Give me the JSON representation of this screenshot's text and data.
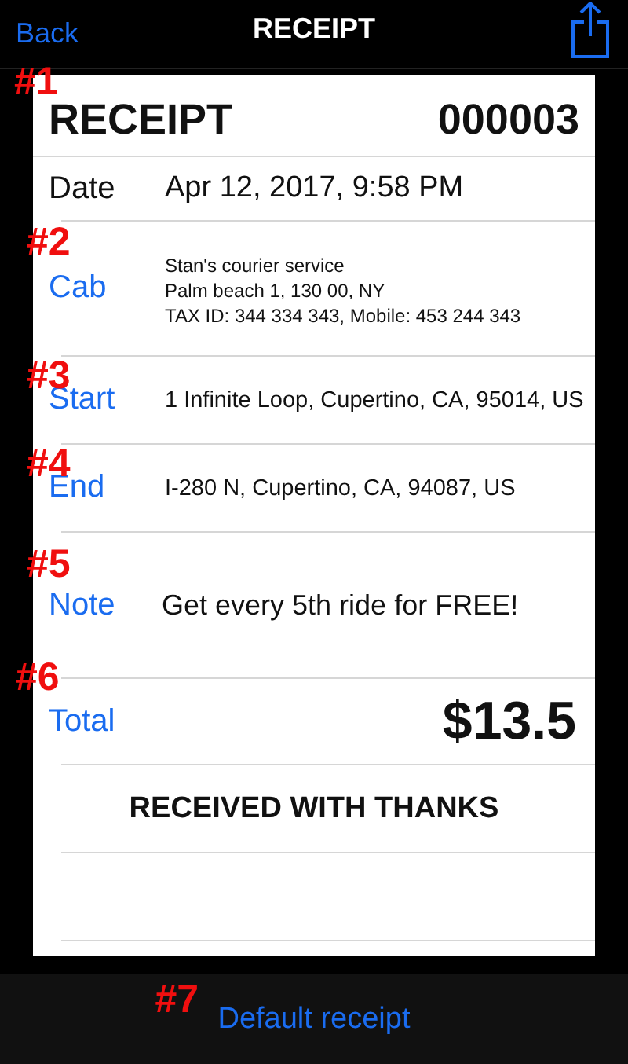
{
  "nav": {
    "back": "Back",
    "title": "RECEIPT"
  },
  "receipt": {
    "marker": "#1",
    "title": "RECEIPT",
    "number": "000003",
    "rows": [
      {
        "kind": "date",
        "label": "Date",
        "value": "Apr 12, 2017, 9:58 PM"
      },
      {
        "kind": "small",
        "marker": "#2",
        "label": "Cab",
        "value": "Stan's courier service\nPalm beach 1, 130 00, NY\nTAX ID: 344 334 343, Mobile: 453 244 343"
      },
      {
        "kind": "medium",
        "marker": "#3",
        "label": "Start",
        "value": "1 Infinite Loop, Cupertino, CA, 95014, US"
      },
      {
        "kind": "medium",
        "marker": "#4",
        "label": "End",
        "value": "I-280 N, Cupertino, CA, 94087, US"
      },
      {
        "kind": "note",
        "marker": "#5",
        "label": "Note",
        "value": "Get every 5th ride for FREE!"
      },
      {
        "kind": "total",
        "marker": "#6",
        "label": "Total",
        "value": "$13.5"
      }
    ],
    "thanks": "RECEIVED WITH THANKS"
  },
  "footer": {
    "marker": "#7",
    "link": "Default receipt"
  }
}
